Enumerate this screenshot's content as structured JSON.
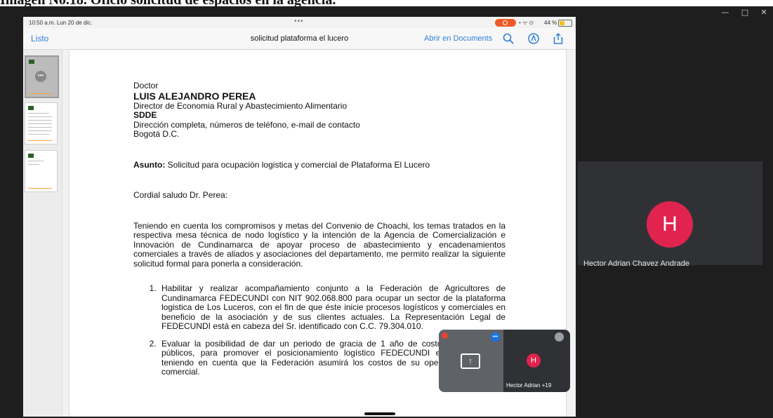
{
  "caption": "Imagen No.18. Oficio solicitud de espacios en la agencia.",
  "window": {
    "minimize": "—",
    "maximize": "□",
    "close": "✕"
  },
  "ipad": {
    "status": {
      "time": "10:50 a.m.  Lun 20 de dic.",
      "dots": "•••",
      "signal": "• ᯤ ⊙",
      "battery_pct": "44 %",
      "battery_level": 0.44
    },
    "nav": {
      "done_label": "Listo",
      "title": "solicitud plataforma el lucero",
      "open_label": "Abrir en Documents",
      "icons": [
        "search-icon",
        "markup-icon",
        "share-icon"
      ]
    },
    "thumb_more": "•••",
    "document": {
      "salutation_title": "Doctor",
      "recipient_name": "LUIS ALEJANDRO PEREA",
      "recipient_position": "Director de Economia Rural y Abastecimiento Alimentario",
      "recipient_org": "SDDE",
      "recipient_contact": "Dirección completa, números de teléfono, e-mail de contacto",
      "recipient_city": "Bogotá D.C.",
      "subject_label": "Asunto:",
      "subject_text": "Solicitud para ocupación logistica y comercial de Plataforma El Lucero",
      "greeting": "Cordial saludo Dr. Perea:",
      "body": "Teniendo en cuenta los compromisos y metas del Convenio de Choachi, los temas tratados en la respectiva mesa técnica de nodo logístico y la intención de la Agencia de Comercialización e Innovación de Cundinamarca de apoyar proceso de abastecimiento y encadenamientos comerciales a través de aliados y asociaciones del departamento, me permito realizar la siguiente solicitud formal para ponerla a consideración.",
      "items": [
        "Habilitar y realizar acompañamiento conjunto a la Federación de Agricultores de Cundinamarca FEDECUNDI con NIT 902.068.800 para ocupar un sector de la plataforma logistica de Los Luceros, con el fin de que éste inicie procesos logísticos y comerciales en beneficio de la asociación y de sus clientes actuales. La Representación Legal de FEDECUNDI está en cabeza del Sr. identificado con C.C. 79.304.010.",
        "Evaluar la posibilidad de dar un periodo de gracia de 1 año de costos y de servicios públicos, para promover el posicionamiento logístico FEDECUNDI en la plataforma, teniendo en cuenta que la Federación asumirá los costos de su operación logística y comercial."
      ]
    }
  },
  "meet": {
    "participant_initial": "H",
    "participant_name": "Hector Adrian Chavez Andrade",
    "pip": {
      "self_initial": "H",
      "name_label": "Hector Adrian",
      "more_count": "+19",
      "present_glyph": "↑",
      "indicator_glyph": "•••"
    }
  }
}
